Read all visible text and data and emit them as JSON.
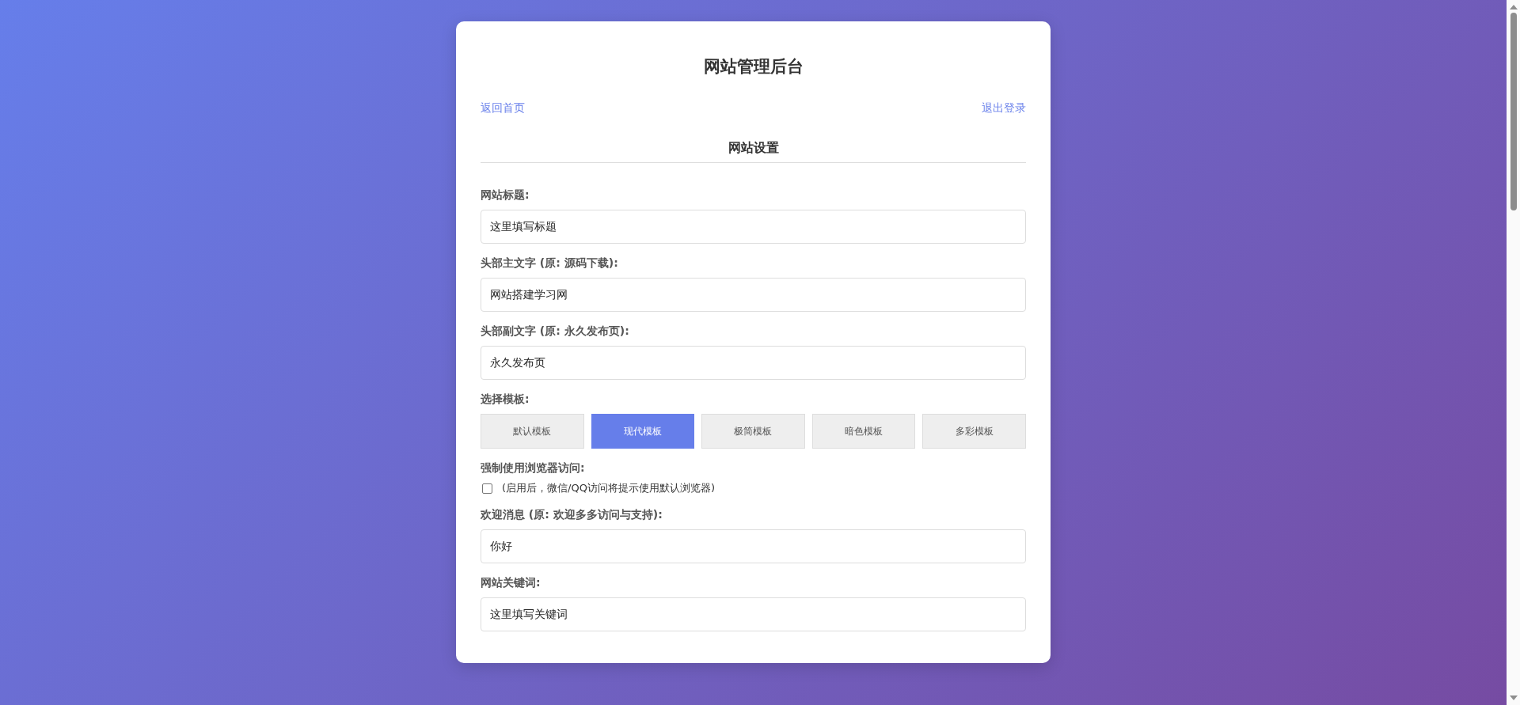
{
  "title": "网站管理后台",
  "nav": {
    "back": "返回首页",
    "logout": "退出登录"
  },
  "section": {
    "title": "网站设置"
  },
  "fields": [
    {
      "kind": "text",
      "label": "网站标题:",
      "value": "这里填写标题"
    },
    {
      "kind": "text",
      "label": "头部主文字 (原: 源码下载):",
      "value": "网站搭建学习网"
    },
    {
      "kind": "text",
      "label": "头部副文字 (原: 永久发布页):",
      "value": "永久发布页"
    },
    {
      "kind": "templates",
      "label": "选择模板:",
      "options": [
        {
          "label": "默认模板",
          "selected": false
        },
        {
          "label": "现代模板",
          "selected": true
        },
        {
          "label": "极简模板",
          "selected": false
        },
        {
          "label": "暗色模板",
          "selected": false
        },
        {
          "label": "多彩模板",
          "selected": false
        }
      ]
    },
    {
      "kind": "checkbox",
      "label": "强制使用浏览器访问:",
      "checked": false,
      "hint": "(启用后，微信/QQ访问将提示使用默认浏览器)"
    },
    {
      "kind": "text",
      "label": "欢迎消息 (原: 欢迎多多访问与支持):",
      "value": "你好"
    },
    {
      "kind": "text",
      "label": "网站关键词:",
      "value": "这里填写关键词"
    }
  ]
}
